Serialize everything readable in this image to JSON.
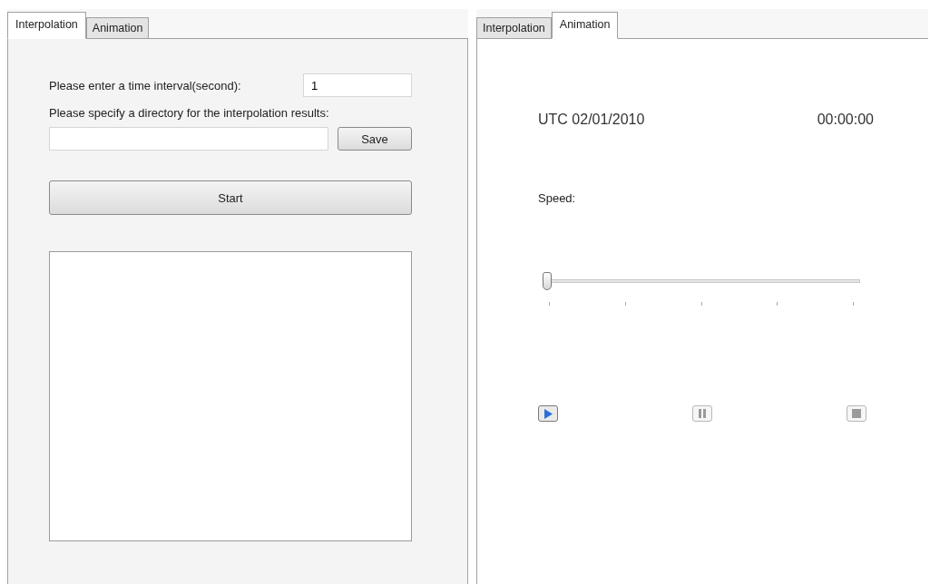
{
  "left_panel": {
    "tabs": [
      {
        "label": "Interpolation",
        "selected": true
      },
      {
        "label": "Animation",
        "selected": false
      }
    ],
    "interval_label": "Please enter a time interval(second):",
    "interval_value": "1",
    "directory_label": "Please specify a directory for the interpolation results:",
    "save_button": "Save",
    "start_button": "Start"
  },
  "right_panel": {
    "tabs": [
      {
        "label": "Interpolation",
        "selected": false
      },
      {
        "label": "Animation",
        "selected": true
      }
    ],
    "date": "UTC 02/01/2010",
    "time": "00:00:00",
    "speed_label": "Speed:",
    "speed_slider": {
      "level": 0
    },
    "controls": [
      {
        "kind": "play",
        "disabled": false
      },
      {
        "kind": "pause",
        "disabled": true
      },
      {
        "kind": "stop",
        "disabled": true
      }
    ]
  }
}
